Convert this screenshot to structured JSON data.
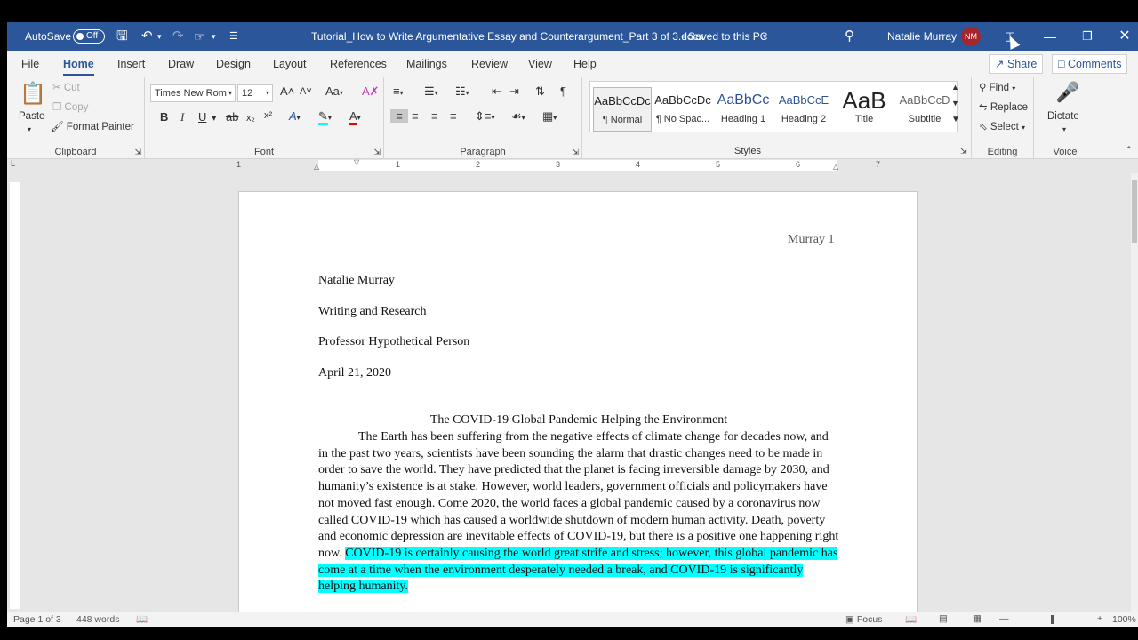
{
  "titlebar": {
    "autosave_label": "AutoSave",
    "autosave_state": "Off",
    "doc_title": "Tutorial_How to Write Argumentative Essay and Counterargument_Part 3 of 3.docx",
    "save_status": "Saved to this PC",
    "user_name": "Natalie Murray",
    "user_initials": "NM"
  },
  "tabs": [
    "File",
    "Home",
    "Insert",
    "Draw",
    "Design",
    "Layout",
    "References",
    "Mailings",
    "Review",
    "View",
    "Help"
  ],
  "active_tab": "Home",
  "share_label": "Share",
  "comments_label": "Comments",
  "ribbon": {
    "clipboard": {
      "paste": "Paste",
      "cut": "Cut",
      "copy": "Copy",
      "format_painter": "Format Painter",
      "label": "Clipboard"
    },
    "font": {
      "name": "Times New Rom",
      "size": "12",
      "label": "Font"
    },
    "paragraph": {
      "label": "Paragraph"
    },
    "styles": {
      "items": [
        {
          "preview": "AaBbCcDc",
          "name": "¶ Normal"
        },
        {
          "preview": "AaBbCcDc",
          "name": "¶ No Spac..."
        },
        {
          "preview": "AaBbCc",
          "name": "Heading 1"
        },
        {
          "preview": "AaBbCcE",
          "name": "Heading 2"
        },
        {
          "preview": "AaB",
          "name": "Title"
        },
        {
          "preview": "AaBbCcD",
          "name": "Subtitle"
        }
      ],
      "label": "Styles"
    },
    "editing": {
      "find": "Find",
      "replace": "Replace",
      "select": "Select",
      "label": "Editing"
    },
    "voice": {
      "dictate": "Dictate",
      "label": "Voice"
    }
  },
  "ruler_numbers": [
    "1",
    "1",
    "2",
    "3",
    "4",
    "5",
    "6",
    "7"
  ],
  "document": {
    "header": "Murray 1",
    "author": "Natalie Murray",
    "course": "Writing and Research",
    "professor": "Professor Hypothetical Person",
    "date": "April 21, 2020",
    "title": "The COVID-19 Global Pandemic Helping the Environment",
    "body": "The Earth has been suffering from the negative effects of climate change for decades now, and in the past two years, scientists have been sounding the alarm that drastic changes need to be made in order to save the world. They have predicted that the planet is facing irreversible damage by 2030, and humanity’s existence is at stake. However, world leaders, government officials and policymakers have not moved fast enough. Come 2020, the world faces a global pandemic caused by a coronavirus now called COVID-19 which has caused a worldwide shutdown of modern human activity. Death, poverty and economic depression are inevitable effects of COVID-19, but there is a positive one happening right now.",
    "highlight": "COVID-19 is certainly causing the world great strife and stress; however, this global pandemic has come at a time when the environment desperately needed a break, and COVID-19 is significantly helping humanity."
  },
  "status": {
    "page": "Page 1 of 3",
    "words": "448 words",
    "focus": "Focus",
    "zoom": "100%"
  }
}
